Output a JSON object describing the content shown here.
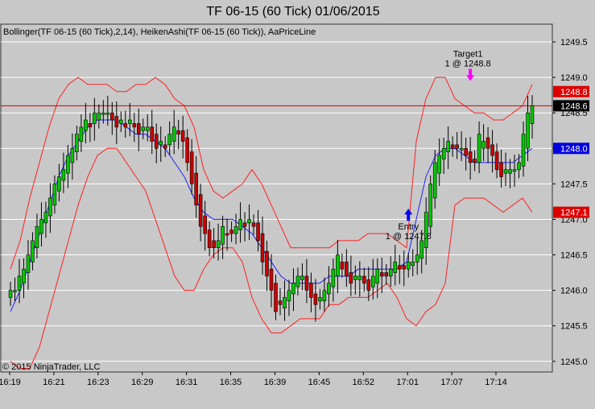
{
  "chart_data": {
    "type": "candlestick",
    "title": "TF 06-15 (60 Tick)  01/06/2015",
    "indicators_label": "Bollinger(TF 06-15 (60 Tick),2,14), HeikenAshi(TF 06-15 (60 Tick)), AaPriceLine",
    "copyright": "© 2015 NinjaTrader, LLC",
    "ylim": [
      1244.85,
      1249.75
    ],
    "y_ticks": [
      "1245.0",
      "1245.5",
      "1246.0",
      "1246.5",
      "1247.0",
      "1247.5",
      "1248.0",
      "1248.5",
      "1249.0",
      "1249.5"
    ],
    "x_ticks": [
      "16:19",
      "16:21",
      "16:23",
      "16:29",
      "16:31",
      "16:35",
      "16:39",
      "16:45",
      "16:52",
      "17:01",
      "17:07",
      "17:14"
    ],
    "price_tags": [
      {
        "value": 1248.8,
        "label": "1248.8",
        "color": "#dd0000"
      },
      {
        "value": 1248.6,
        "label": "1248.6",
        "color": "#000000"
      },
      {
        "value": 1248.0,
        "label": "1248.0",
        "color": "#0000dd"
      },
      {
        "value": 1247.1,
        "label": "1247.1",
        "color": "#dd0000"
      }
    ],
    "price_line": 1248.6,
    "colors": {
      "up": "#00c800",
      "down": "#cc0000",
      "band": "#ff2020",
      "mid": "#2020ff",
      "price_line": "#cc0000",
      "bg": "#c8c8c8"
    },
    "annotations": [
      {
        "name": "entry",
        "line1": "Entry",
        "line2": "1 @ 1247.8",
        "arrow": "up",
        "arrow_color": "#0000ff",
        "bar_index": 90
      },
      {
        "name": "target",
        "line1": "Target1",
        "line2": "1 @ 1248.8",
        "arrow": "down",
        "arrow_color": "#ff00ff",
        "bar_index": 104
      }
    ],
    "series": [
      {
        "name": "HeikenAshi",
        "close": [
          1246.0,
          1246.0,
          1246.2,
          1246.3,
          1246.5,
          1246.7,
          1246.9,
          1247.0,
          1247.1,
          1247.3,
          1247.5,
          1247.6,
          1247.7,
          1247.9,
          1248.0,
          1248.2,
          1248.3,
          1248.4,
          1248.3,
          1248.5,
          1248.5,
          1248.5,
          1248.5,
          1248.4,
          1248.3,
          1248.4,
          1248.3,
          1248.4,
          1248.3,
          1248.2,
          1248.3,
          1248.3,
          1248.1,
          1248.0,
          1248.1,
          1248.0,
          1248.2,
          1248.3,
          1248.2,
          1248.1,
          1247.8,
          1247.5,
          1247.2,
          1246.9,
          1246.8,
          1246.6,
          1246.6,
          1246.7,
          1246.9,
          1246.8,
          1246.8,
          1246.9,
          1247.0,
          1246.9,
          1247.0,
          1246.9,
          1246.7,
          1246.4,
          1246.2,
          1246.0,
          1245.7,
          1245.8,
          1245.9,
          1246.0,
          1246.1,
          1246.2,
          1246.2,
          1246.0,
          1245.9,
          1245.8,
          1245.9,
          1246.0,
          1246.1,
          1246.3,
          1246.5,
          1246.3,
          1246.2,
          1246.1,
          1246.2,
          1246.2,
          1246.1,
          1246.0,
          1246.2,
          1246.3,
          1246.2,
          1246.2,
          1246.3,
          1246.4,
          1246.3,
          1246.3,
          1246.4,
          1246.4,
          1246.5,
          1246.7,
          1247.1,
          1247.5,
          1247.8,
          1247.9,
          1248.0,
          1248.1,
          1248.0,
          1248.0,
          1248.0,
          1247.9,
          1247.8,
          1247.8,
          1248.2,
          1248.1,
          1248.0,
          1247.9,
          1247.7,
          1247.6,
          1247.7,
          1247.7,
          1247.7,
          1247.8,
          1248.2,
          1248.5,
          1248.6
        ]
      },
      {
        "name": "Bollinger Upper",
        "values": [
          1246.3,
          1246.7,
          1247.3,
          1247.8,
          1248.3,
          1248.7,
          1248.9,
          1249.0,
          1248.9,
          1248.9,
          1248.9,
          1248.8,
          1248.8,
          1248.9,
          1248.9,
          1249.0,
          1248.9,
          1248.7,
          1248.6,
          1248.3,
          1247.7,
          1247.4,
          1247.3,
          1247.4,
          1247.5,
          1247.7,
          1247.5,
          1247.2,
          1246.9,
          1246.6,
          1246.6,
          1246.6,
          1246.6,
          1246.6,
          1246.7,
          1246.7,
          1246.7,
          1246.8,
          1246.8,
          1246.8,
          1246.7,
          1246.6,
          1248.1,
          1248.7,
          1249.0,
          1249.0,
          1248.7,
          1248.6,
          1248.5,
          1248.5,
          1248.4,
          1248.4,
          1248.5,
          1248.6,
          1248.9
        ]
      },
      {
        "name": "Bollinger Middle",
        "values": [
          1245.7,
          1246.0,
          1246.4,
          1246.8,
          1247.2,
          1247.6,
          1247.9,
          1248.1,
          1248.3,
          1248.4,
          1248.4,
          1248.4,
          1248.3,
          1248.2,
          1248.2,
          1248.1,
          1248.0,
          1247.8,
          1247.6,
          1247.3,
          1247.1,
          1247.0,
          1247.0,
          1247.0,
          1246.9,
          1246.8,
          1246.6,
          1246.4,
          1246.2,
          1246.1,
          1246.1,
          1246.1,
          1246.1,
          1246.2,
          1246.2,
          1246.2,
          1246.3,
          1246.3,
          1246.3,
          1246.3,
          1246.3,
          1246.4,
          1247.0,
          1247.6,
          1247.9,
          1248.0,
          1248.0,
          1247.9,
          1247.8,
          1247.8,
          1247.8,
          1247.8,
          1247.8,
          1247.9,
          1248.0
        ]
      },
      {
        "name": "Bollinger Lower",
        "values": [
          1245.0,
          1244.9,
          1244.9,
          1245.2,
          1245.7,
          1246.2,
          1246.7,
          1247.2,
          1247.6,
          1247.9,
          1248.0,
          1248.0,
          1247.8,
          1247.6,
          1247.4,
          1247.0,
          1246.6,
          1246.2,
          1246.0,
          1246.0,
          1246.3,
          1246.5,
          1246.6,
          1246.6,
          1246.4,
          1245.9,
          1245.6,
          1245.4,
          1245.4,
          1245.5,
          1245.6,
          1245.6,
          1245.6,
          1245.8,
          1245.8,
          1245.9,
          1245.9,
          1245.9,
          1246.0,
          1246.1,
          1245.9,
          1245.6,
          1245.5,
          1245.7,
          1245.8,
          1246.1,
          1247.2,
          1247.3,
          1247.3,
          1247.3,
          1247.2,
          1247.1,
          1247.2,
          1247.3,
          1247.1
        ]
      }
    ]
  }
}
